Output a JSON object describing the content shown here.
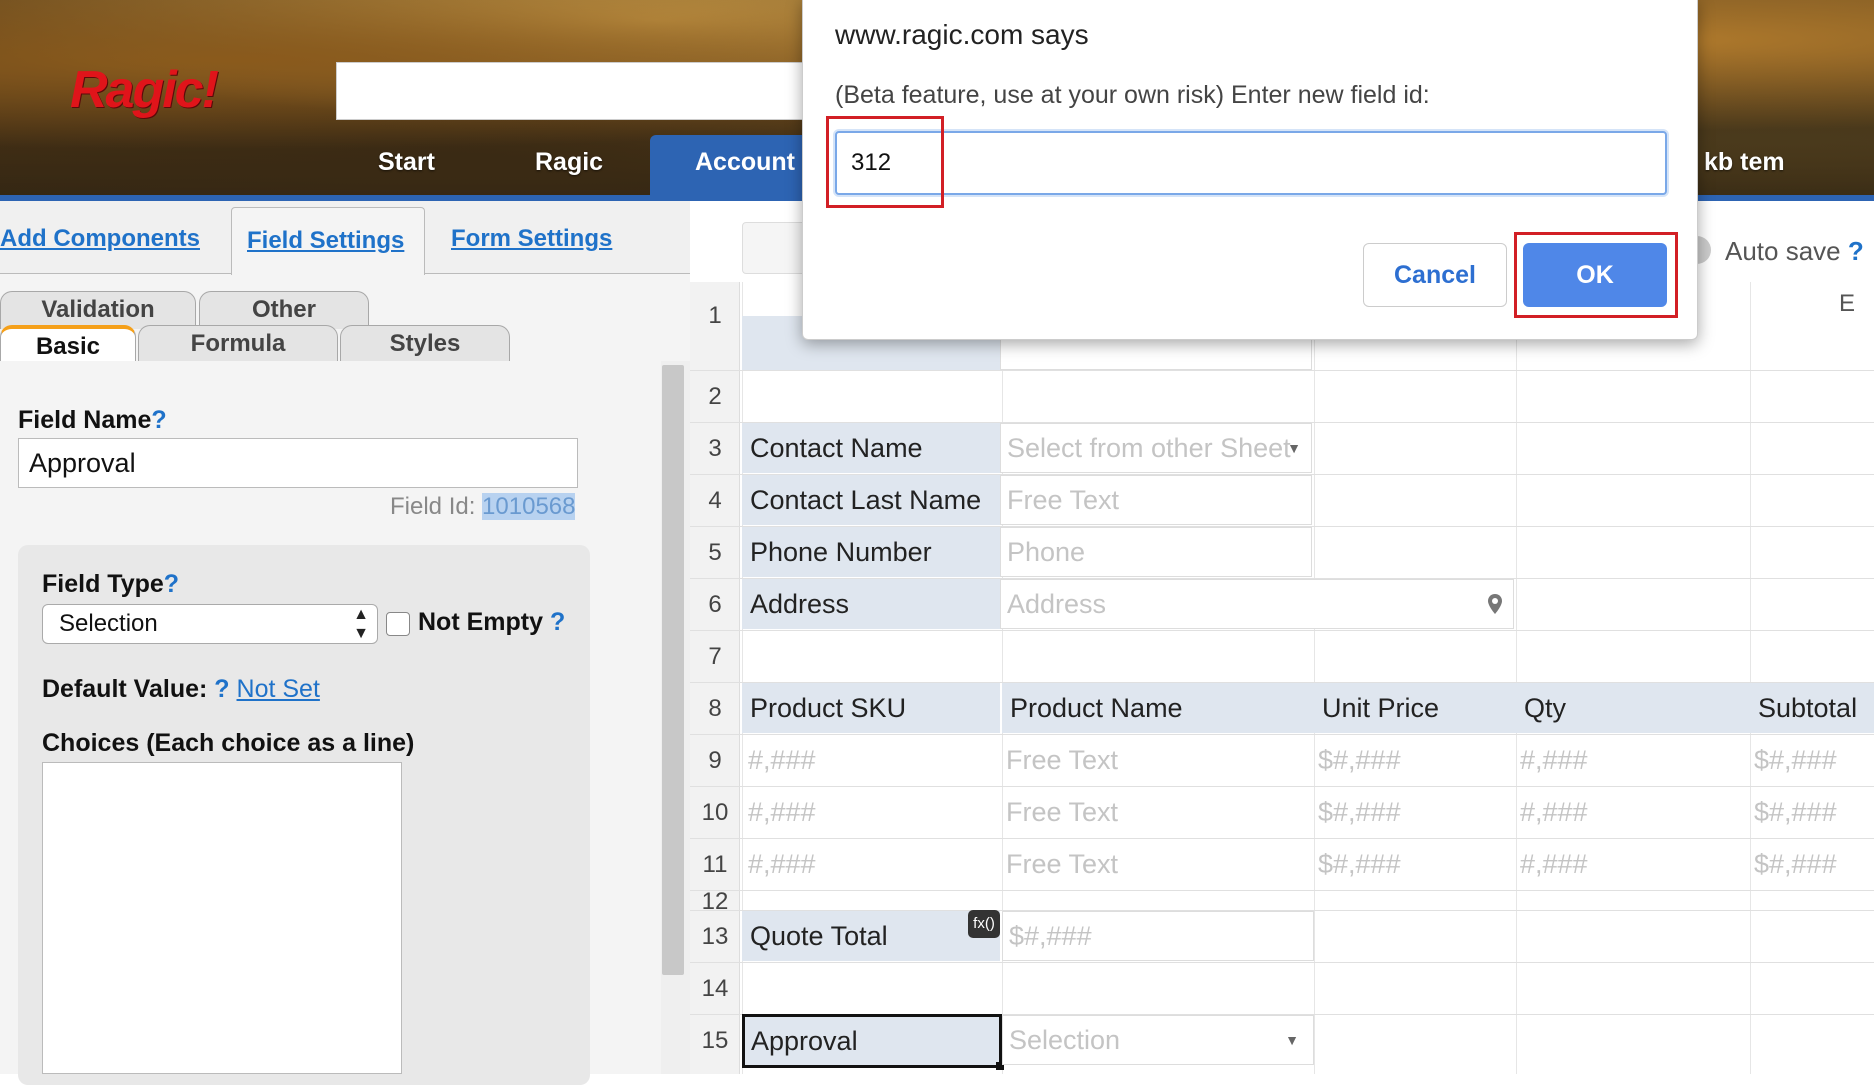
{
  "header": {
    "logo": "Ragic!",
    "nav": {
      "start": "Start",
      "ragic": "Ragic",
      "account": "Account",
      "user": "kb tem"
    }
  },
  "left_panel": {
    "tabs": {
      "add_components": "Add Components",
      "field_settings": "Field Settings",
      "form_settings": "Form Settings"
    },
    "subtabs": {
      "validation": "Validation",
      "other": "Other",
      "basic": "Basic",
      "formula": "Formula",
      "styles": "Styles"
    },
    "field_name_label": "Field Name",
    "help_mark": "?",
    "field_name_value": "Approval",
    "field_id_label": "Field Id:",
    "field_id_value": "1010568",
    "field_type_label": "Field Type",
    "field_type_value": "Selection",
    "not_empty_label": "Not Empty",
    "default_value_label": "Default Value:",
    "default_value_link": "Not Set",
    "choices_label": "Choices (Each choice as a line)"
  },
  "sheet": {
    "autosave_label": "Auto save",
    "column_e": "E",
    "row_numbers": [
      "1",
      "2",
      "3",
      "4",
      "5",
      "6",
      "7",
      "8",
      "9",
      "10",
      "11",
      "12",
      "13",
      "14",
      "15"
    ],
    "contact_name": "Contact Name",
    "contact_name_ph": "Select from other Sheet",
    "contact_last_name": "Contact Last Name",
    "contact_last_name_ph": "Free Text",
    "phone_number": "Phone Number",
    "phone_ph": "Phone",
    "address": "Address",
    "address_ph": "Address",
    "headers": [
      "Product SKU",
      "Product Name",
      "Unit Price",
      "Qty",
      "Subtotal"
    ],
    "row_placeholders": [
      "#,###",
      "Free Text",
      "$#,###",
      "#,###",
      "$#,###"
    ],
    "quote_total": "Quote Total",
    "fx_badge": "fx()",
    "quote_total_ph": "$#,###",
    "approval": "Approval",
    "approval_ph": "Selection"
  },
  "dialog": {
    "title": "www.ragic.com says",
    "message": "(Beta feature, use at your own risk) Enter new field id:",
    "input_value": "312",
    "cancel": "Cancel",
    "ok": "OK"
  },
  "colors": {
    "brand_blue": "#2d64b3",
    "link_blue": "#1f72c9",
    "ok_blue": "#4f87e8",
    "highlight_red": "#d21f25",
    "label_cell_bg": "#dfe6ef"
  }
}
